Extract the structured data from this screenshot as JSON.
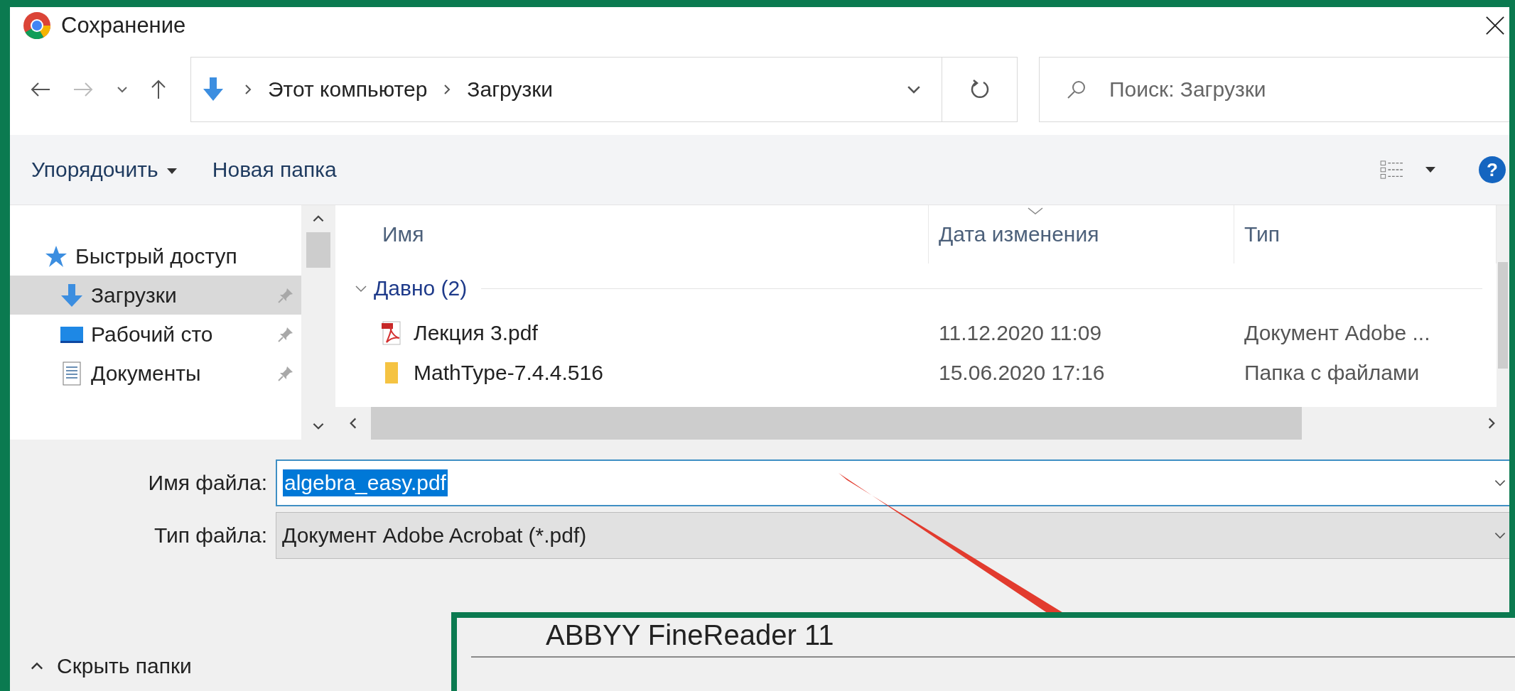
{
  "window": {
    "title": "Сохранение"
  },
  "address": {
    "path": [
      "Этот компьютер",
      "Загрузки"
    ]
  },
  "search": {
    "placeholder": "Поиск: Загрузки"
  },
  "toolbar": {
    "organize": "Упорядочить",
    "new_folder": "Новая папка",
    "help": "?"
  },
  "sidebar": {
    "items": [
      {
        "label": "Быстрый доступ",
        "kind": "star",
        "selected": false,
        "pinned": false
      },
      {
        "label": "Загрузки",
        "kind": "download",
        "selected": true,
        "pinned": true
      },
      {
        "label": "Рабочий сто",
        "kind": "desktop",
        "selected": false,
        "pinned": true
      },
      {
        "label": "Документы",
        "kind": "documents",
        "selected": false,
        "pinned": true
      }
    ]
  },
  "file_list": {
    "columns": [
      {
        "label": "Имя",
        "sorted": false
      },
      {
        "label": "Дата изменения",
        "sorted": true
      },
      {
        "label": "Тип",
        "sorted": false
      }
    ],
    "groups": [
      {
        "label": "Давно (2)",
        "expanded": true,
        "rows": [
          {
            "name": "Лекция 3.pdf",
            "kind": "pdf",
            "date": "11.12.2020 11:09",
            "type": "Документ Adobe ..."
          },
          {
            "name": "MathType-7.4.4.516",
            "kind": "folder",
            "date": "15.06.2020 17:16",
            "type": "Папка с файлами"
          }
        ]
      }
    ]
  },
  "form": {
    "filename_label": "Имя файла:",
    "filename": "algebra_easy.pdf",
    "filename_selected": true,
    "filetype_label": "Тип файла:",
    "filetype": "Документ Adobe Acrobat (*.pdf)"
  },
  "hide_folders": "Скрыть папки",
  "overlay": {
    "title": "ABBYY FineReader 11"
  }
}
